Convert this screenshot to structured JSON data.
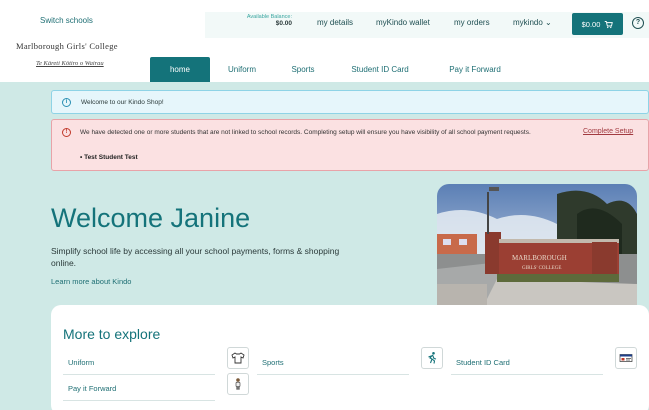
{
  "header": {
    "switch_schools": "Switch schools",
    "school_name": "Marlborough Girls' College",
    "school_tagline": "Te Kāreti Kōtiro o Wairau",
    "balance_label": "Available Balance:",
    "balance_value": "$0.00",
    "links": [
      "my details",
      "myKindo wallet",
      "my orders",
      "mykindo ⌄"
    ],
    "cart_label": "$0.00",
    "help_label": "?"
  },
  "tabs": [
    "home",
    "Uniform",
    "Sports",
    "Student ID Card",
    "Pay it Forward"
  ],
  "active_tab": "home",
  "info_banner": {
    "icon": "info-icon",
    "text": "Welcome to our Kindo Shop!"
  },
  "warning_banner": {
    "icon": "alert-icon",
    "message": "We have detected one or more students that are not linked to school records. Completing setup will ensure you have visibility of all school payment requests.",
    "student": "• Test Student Test",
    "cta": "Complete Setup"
  },
  "hero": {
    "title": "Welcome Janine",
    "subtitle": "Simplify school life by accessing all your school payments, forms & shopping online.",
    "learn_more": "Learn more about Kindo"
  },
  "explore": {
    "title": "More to explore",
    "items": [
      {
        "label": "Uniform",
        "icon": "shirt-icon"
      },
      {
        "label": "Sports",
        "icon": "runner-icon"
      },
      {
        "label": "Student ID Card",
        "icon": "id-card-icon"
      },
      {
        "label": "Pay it Forward",
        "icon": "person-icon"
      }
    ]
  },
  "colors": {
    "brand": "#14737a",
    "page_bg": "#cfe9e6",
    "info_bg": "#e6f6fb",
    "warn_bg": "#fbe1e2"
  }
}
